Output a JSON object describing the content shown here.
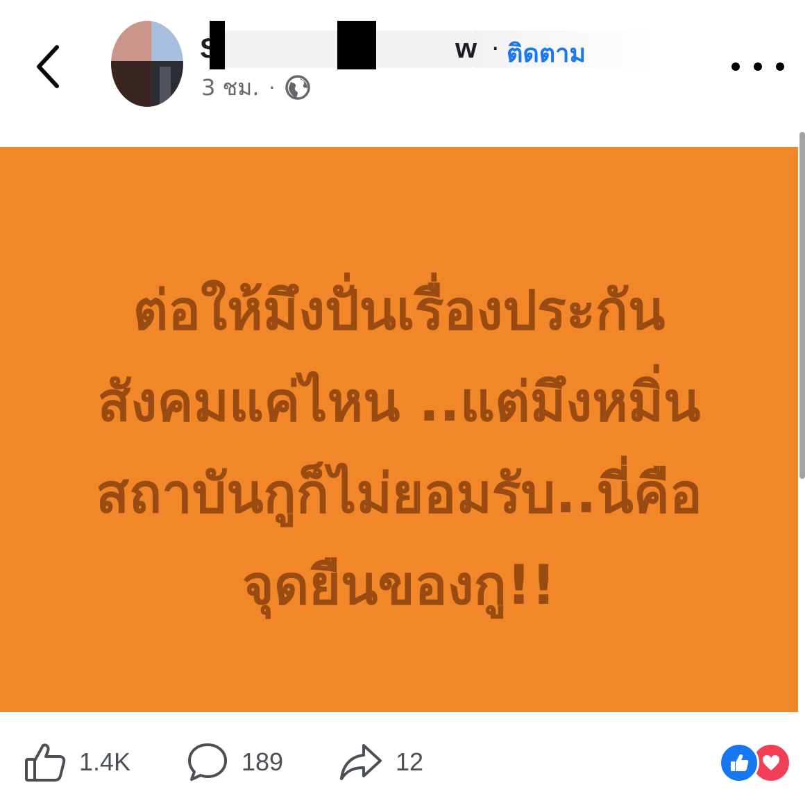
{
  "header": {
    "name_visible_start": "Sa",
    "name_visible_end": "w",
    "dot": "·",
    "follow_label": "ติดตาม",
    "time": "3 ชม.",
    "meta_sep": "·",
    "privacy_icon": "globe-icon",
    "back_icon": "chevron-left-icon",
    "more_icon": "more-horizontal-icon"
  },
  "post": {
    "background_color": "#f2872a",
    "text_color": "#9a4b12",
    "lines": [
      "ต่อให้มึงปั่นเรื่องประกัน",
      "สังคมแค่ไหน ..แต่มึงหมิ่น",
      "สถาบันกูก็ไม่ยอมรับ..นี่คือ",
      "จุดยืนของกู!!"
    ]
  },
  "actions": {
    "like_count": "1.4K",
    "comment_count": "189",
    "share_count": "12",
    "like_icon": "thumbs-up-icon",
    "comment_icon": "comment-icon",
    "share_icon": "share-icon"
  },
  "reactions": {
    "icons": [
      "like-reaction-icon",
      "love-reaction-icon"
    ],
    "like_color": "#1877f2",
    "love_color": "#f33e58"
  },
  "colors": {
    "accent": "#1877f2",
    "secondary_text": "#65676b"
  }
}
